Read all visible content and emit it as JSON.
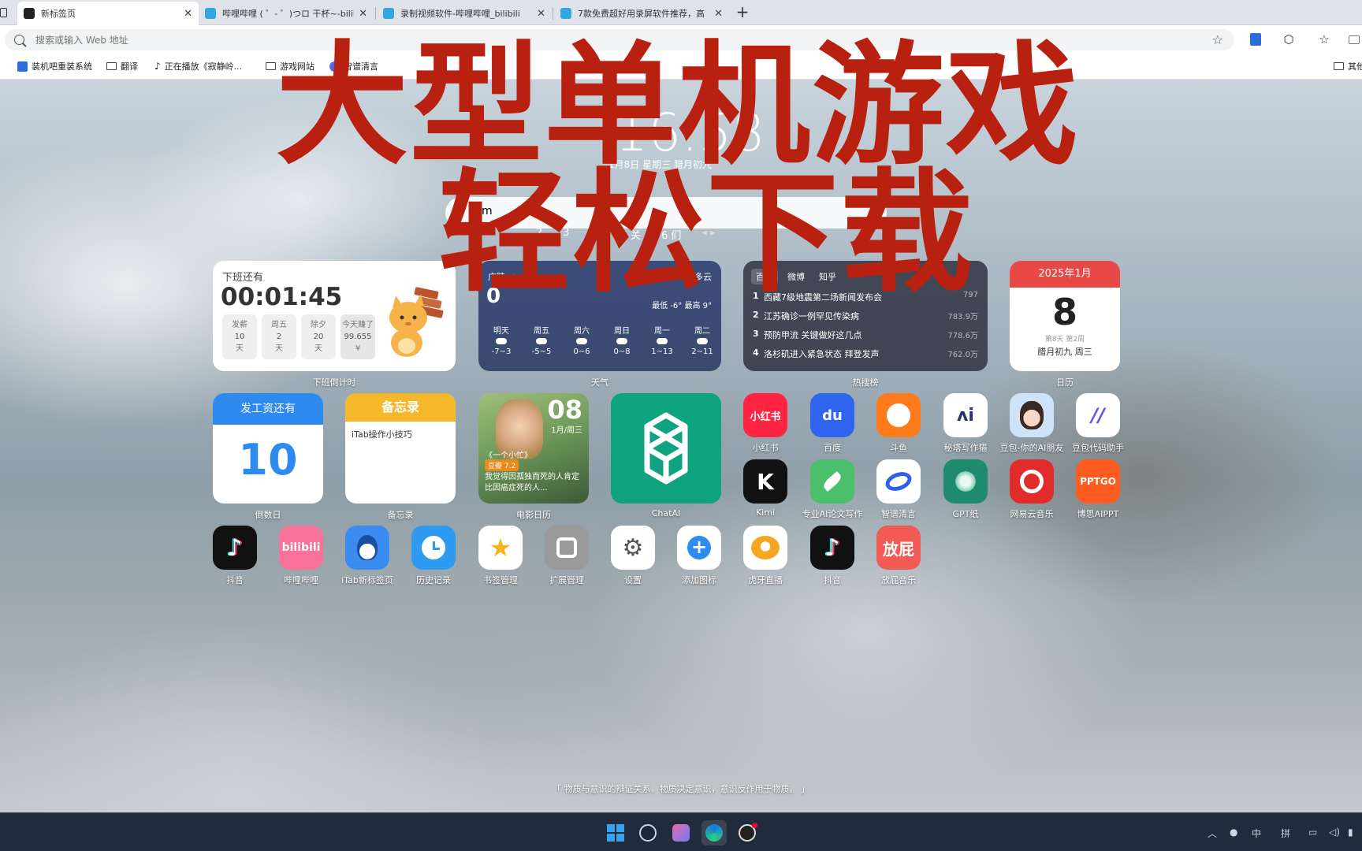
{
  "browser": {
    "tabs": [
      {
        "title": "新标签页",
        "active": true
      },
      {
        "title": "哔哩哔哩 ( ゜- ゜)つロ 干杯~-bilibili",
        "active": false
      },
      {
        "title": "录制视频软件-哔哩哔哩_bilibili",
        "active": false
      },
      {
        "title": "7款免费超好用录屏软件推荐，高",
        "active": false
      }
    ],
    "new_tab": "+",
    "address_placeholder": "搜索或输入 Web 地址",
    "bookmarks": [
      "装机吧重装系统",
      "翻译",
      "正在播放《寂静岭...",
      "游戏网站",
      "智谱清言"
    ],
    "bookmarks_other": "其他"
  },
  "overlay_title": {
    "line1": "大型单机游戏",
    "line2": "轻松下载"
  },
  "clock": {
    "time": "16:58",
    "date": "1月8日 星期三 腊月初九"
  },
  "search": {
    "value": "m",
    "tabs": [
      "2",
      "3",
      "听",
      "5 关",
      "6 们"
    ]
  },
  "widgets": {
    "offwork": {
      "title": "下班还有",
      "timer": "00:01:45",
      "items": [
        {
          "label": "发薪",
          "num": "10",
          "unit": "天"
        },
        {
          "label": "周五",
          "num": "2",
          "unit": "天"
        },
        {
          "label": "除夕",
          "num": "20",
          "unit": "天"
        },
        {
          "label": "今天赚了",
          "num": "99.655",
          "unit": "¥"
        }
      ],
      "caption": "下班倒计时"
    },
    "weather": {
      "location": "广陵 ◁",
      "condition": "多云",
      "temp": "0",
      "range": "最低 -6° 最高 9°",
      "forecast": [
        {
          "day": "明天",
          "range": "-7~3"
        },
        {
          "day": "周五",
          "range": "-5~5"
        },
        {
          "day": "周六",
          "range": "0~6"
        },
        {
          "day": "周日",
          "range": "0~8"
        },
        {
          "day": "周一",
          "range": "1~13"
        },
        {
          "day": "周二",
          "range": "2~11"
        }
      ],
      "caption": "天气"
    },
    "hot": {
      "tabs": [
        "百度",
        "微博",
        "知乎"
      ],
      "rows": [
        {
          "rank": "1",
          "title": "西藏7级地震第二场新闻发布会",
          "heat": "797"
        },
        {
          "rank": "2",
          "title": "江苏确诊一例罕见传染病",
          "heat": "783.9万"
        },
        {
          "rank": "3",
          "title": "预防甲流 关键做好这几点",
          "heat": "778.6万"
        },
        {
          "rank": "4",
          "title": "洛杉矶进入紧急状态 拜登发声",
          "heat": "762.0万"
        }
      ],
      "caption": "热搜榜"
    },
    "calendar": {
      "header": "2025年1月",
      "day": "8",
      "sub": "第8天 第2周",
      "lunar": "腊月初九 周三",
      "caption": "日历"
    },
    "countdown": {
      "header": "发工资还有",
      "num": "10",
      "caption": "倒数日"
    },
    "memo": {
      "header": "备忘录",
      "text": "iTab操作小技巧",
      "caption": "备忘录"
    },
    "movie": {
      "day": "08",
      "week": "1月/周三",
      "title": "《一个小忙》",
      "rating": "豆瓣 7.2",
      "quote": "我觉得因孤独而死的人肯定比因癌症死的人...",
      "caption": "电影日历"
    },
    "chatai": {
      "caption": "ChatAI"
    }
  },
  "apps_row1": [
    {
      "label": "小红书",
      "text": "小红书",
      "color": "#ff2442"
    },
    {
      "label": "百度",
      "text": "du",
      "color": "#2e64ee"
    },
    {
      "label": "斗鱼",
      "text": "",
      "color": "#ff7a1a"
    },
    {
      "label": "秘塔写作猫",
      "text": "ʌi",
      "color": "#ffffff"
    },
    {
      "label": "豆包-你的AI朋友",
      "text": "",
      "color": "#cfe3f8"
    },
    {
      "label": "豆包代码助手",
      "text": "//",
      "color": "#ffffff"
    }
  ],
  "apps_row2": [
    {
      "label": "Kimi",
      "text": "K",
      "color": "#111111"
    },
    {
      "label": "专业AI论文写作",
      "text": "",
      "color": "#4cbf6a"
    },
    {
      "label": "智谱清言",
      "text": "",
      "color": "#ffffff"
    },
    {
      "label": "GPT纸",
      "text": "",
      "color": "#1e8a6e"
    },
    {
      "label": "网易云音乐",
      "text": "",
      "color": "#e22b2b"
    },
    {
      "label": "博思AIPPT",
      "text": "PPTGO",
      "color": "#ff5a1f"
    }
  ],
  "apps_row3": [
    {
      "label": "抖音",
      "text": "♪",
      "color": "#111111"
    },
    {
      "label": "哔哩哔哩",
      "text": "bilibili",
      "color": "#fb7299"
    },
    {
      "label": "iTab新标签页",
      "text": "",
      "color": "#3b8cf0"
    },
    {
      "label": "历史记录",
      "text": "",
      "color": "#2e9bf0"
    },
    {
      "label": "书签管理",
      "text": "★",
      "color": "#ffffff"
    },
    {
      "label": "扩展管理",
      "text": "",
      "color": "#9a9a9a"
    },
    {
      "label": "设置",
      "text": "⚙",
      "color": "#ffffff"
    },
    {
      "label": "添加图标",
      "text": "+",
      "color": "#ffffff"
    },
    {
      "label": "虎牙直播",
      "text": "",
      "color": "#ffffff"
    },
    {
      "label": "抖音",
      "text": "♪",
      "color": "#111111"
    },
    {
      "label": "放屁音乐",
      "text": "放屁",
      "color": "#f25a55"
    }
  ],
  "footer_quote": "「 物质与意识的辩证关系，物质决定意识，意识反作用于物质。 」",
  "taskbar": {
    "tray_ime": "中",
    "tray_pin": "拼"
  }
}
